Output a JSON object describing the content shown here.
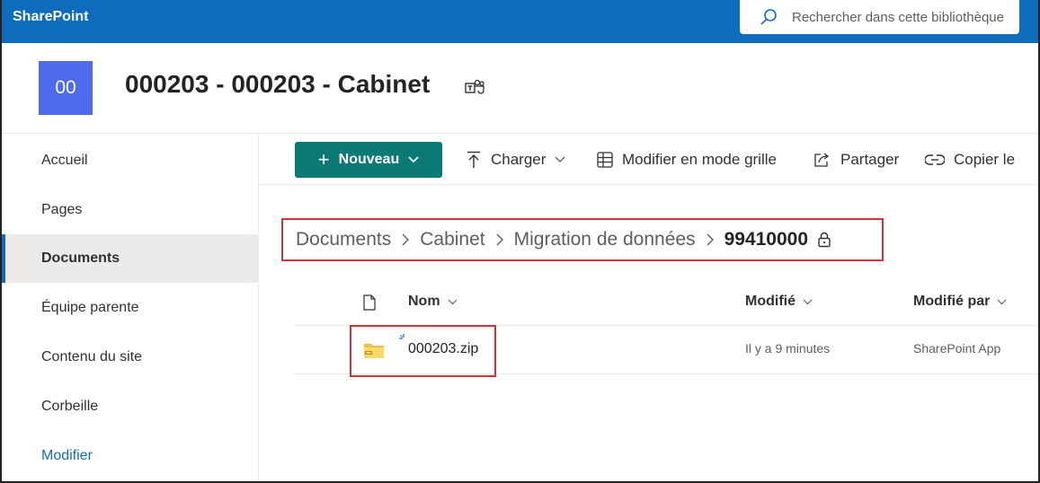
{
  "suite": {
    "brand": "SharePoint",
    "search_placeholder": "Rechercher dans cette bibliothèque"
  },
  "site": {
    "logo_initials": "00",
    "title": "000203 - 000203 - Cabinet"
  },
  "nav": {
    "items": [
      {
        "label": "Accueil"
      },
      {
        "label": "Pages"
      },
      {
        "label": "Documents"
      },
      {
        "label": "Équipe parente"
      },
      {
        "label": "Contenu du site"
      },
      {
        "label": "Corbeille"
      },
      {
        "label": "Modifier"
      }
    ],
    "active": "Documents"
  },
  "commands": {
    "new_label": "Nouveau",
    "upload_label": "Charger",
    "grid_label": "Modifier en mode grille",
    "share_label": "Partager",
    "copy_label": "Copier le"
  },
  "breadcrumb": {
    "items": [
      "Documents",
      "Cabinet",
      "Migration de données"
    ],
    "current": "99410000"
  },
  "list": {
    "columns": {
      "name": "Nom",
      "modified": "Modifié",
      "modified_by": "Modifié par"
    },
    "rows": [
      {
        "name": "000203.zip",
        "modified": "Il y a 9 minutes",
        "modified_by": "SharePoint App"
      }
    ]
  },
  "colors": {
    "suite_bar": "#0f6cbd",
    "site_logo": "#4f6bed",
    "new_button": "#0b7a75",
    "highlight_box": "#d13438"
  }
}
